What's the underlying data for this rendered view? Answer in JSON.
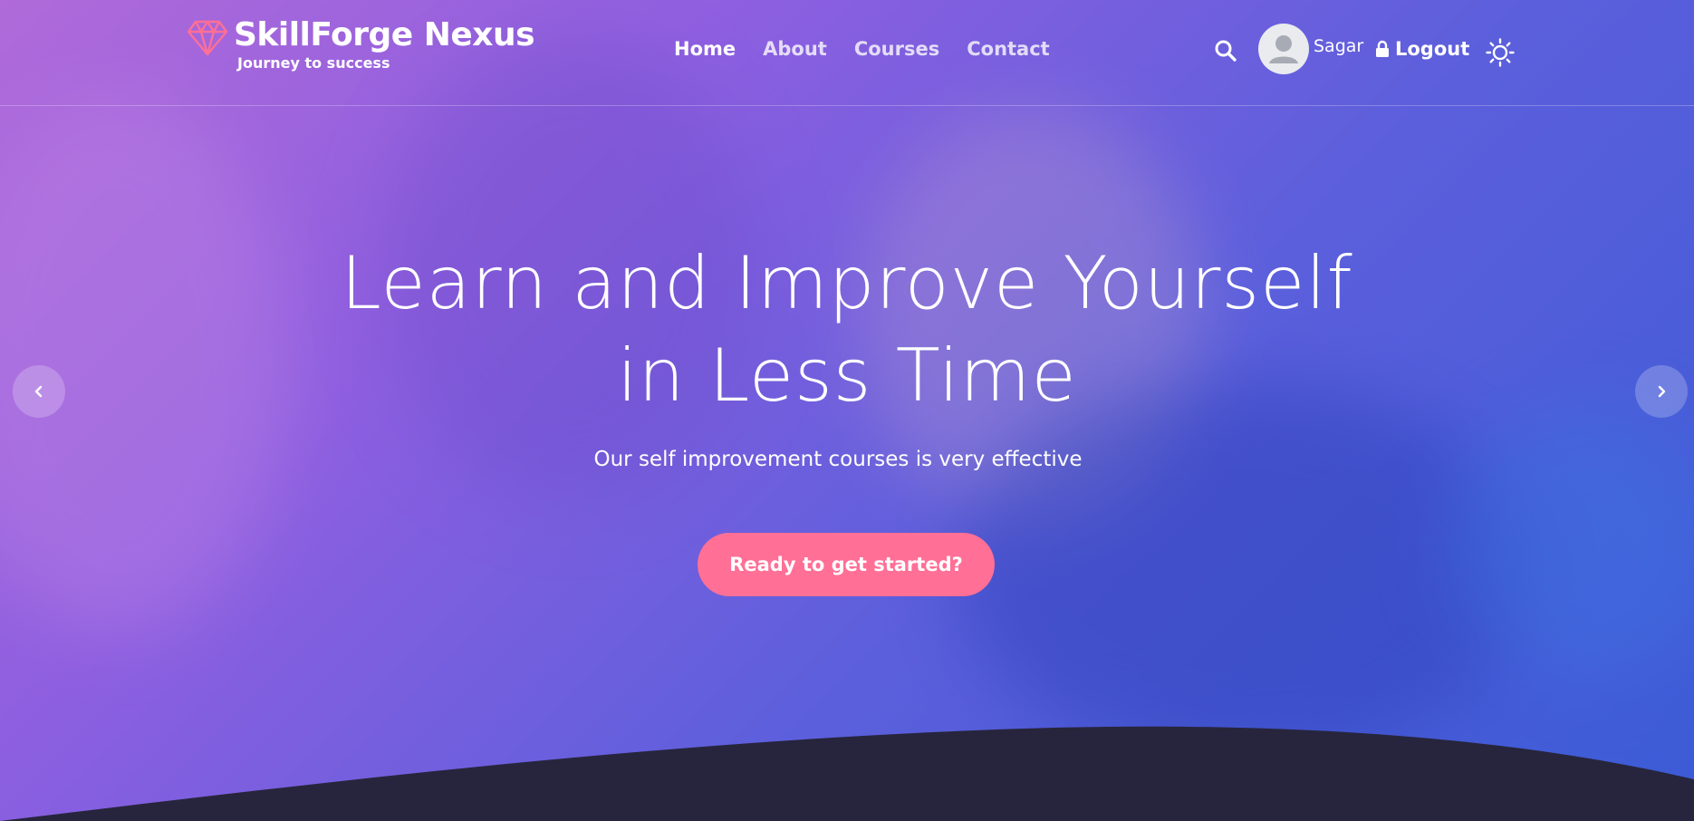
{
  "brand": {
    "name": "SkillForge Nexus",
    "tagline": "Journey to success",
    "logo_icon": "diamond-icon",
    "logo_color": "#ff6f96"
  },
  "nav": {
    "items": [
      {
        "label": "Home",
        "active": true
      },
      {
        "label": "About",
        "active": false
      },
      {
        "label": "Courses",
        "active": false
      },
      {
        "label": "Contact",
        "active": false
      }
    ]
  },
  "header_actions": {
    "search_icon": "search-icon",
    "avatar_icon": "user-avatar-icon",
    "username": "Sagar",
    "logout_label": "Logout",
    "logout_icon": "lock-icon",
    "theme_icon": "sun-icon"
  },
  "hero": {
    "title_line1": "Learn and Improve Yourself",
    "title_line2": "in Less Time",
    "subtitle": "Our self improvement courses is very effective",
    "cta_label": "Ready to get started?",
    "prev_icon": "chevron-left-icon",
    "next_icon": "chevron-right-icon"
  },
  "colors": {
    "accent": "#ff6f96",
    "overlay_start": "#b06ad9",
    "overlay_end": "#3b5bd6",
    "footer_wave": "#27253d"
  }
}
